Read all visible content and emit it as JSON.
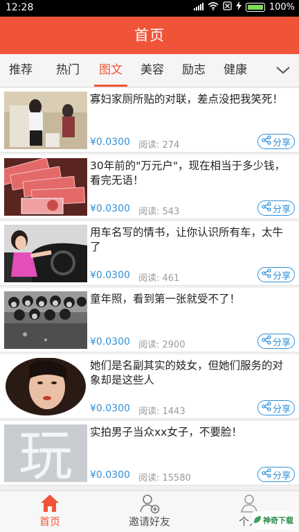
{
  "status_bar": {
    "time": "12:28",
    "battery": "100%"
  },
  "header": {
    "title": "首页"
  },
  "tabs": [
    {
      "label": "推荐"
    },
    {
      "label": "热门"
    },
    {
      "label": "图文"
    },
    {
      "label": "美容"
    },
    {
      "label": "励志"
    },
    {
      "label": "健康"
    }
  ],
  "active_tab": "图文",
  "articles": [
    {
      "title": "寡妇家厕所贴的对联，差点没把我笑死！",
      "price": "¥0.0300",
      "reads": "阅读: 274",
      "share": "分享"
    },
    {
      "title": "30年前的\"万元户\"，现在相当于多少钱，看完无语！",
      "price": "¥0.0300",
      "reads": "阅读: 543",
      "share": "分享"
    },
    {
      "title": "用车名写的情书，让你认识所有车，太牛了",
      "price": "¥0.0300",
      "reads": "阅读: 461",
      "share": "分享"
    },
    {
      "title": "童年照，看到第一张就受不了！",
      "price": "¥0.0300",
      "reads": "阅读: 2900",
      "share": "分享"
    },
    {
      "title": "她们是名副其实的妓女，但她们服务的对象却是这些人",
      "price": "¥0.0300",
      "reads": "阅读: 1443",
      "share": "分享"
    },
    {
      "title": "实拍男子当众xx女子，不要脸！",
      "price": "¥0.0300",
      "reads": "阅读: 15580",
      "share": "分享"
    }
  ],
  "bottom_nav": [
    {
      "label": "首页",
      "icon": "home-icon"
    },
    {
      "label": "邀请好友",
      "icon": "add-user-icon"
    },
    {
      "label": "个人",
      "icon": "user-icon"
    }
  ],
  "thumb_glyph": "玩",
  "watermark": "神奇下载",
  "colors": {
    "brand": "#f05438",
    "accent": "#2f8fd8",
    "status_bar": "#000000"
  }
}
